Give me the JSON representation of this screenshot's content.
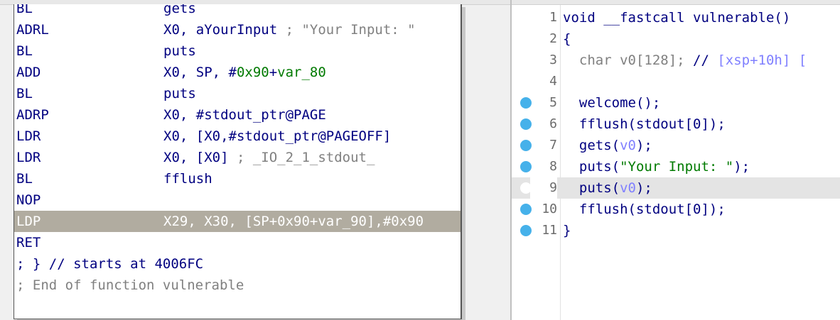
{
  "disassembly": {
    "lines": [
      {
        "mnemonic": "BL",
        "operands": [
          {
            "text": "gets",
            "color": "#000080"
          }
        ]
      },
      {
        "mnemonic": "ADRL",
        "operands": [
          {
            "text": "X0, aYourInput",
            "color": "#000080"
          },
          {
            "text": " ; \"Your Input: \"",
            "color": "#808080"
          }
        ]
      },
      {
        "mnemonic": "BL",
        "operands": [
          {
            "text": "puts",
            "color": "#000080"
          }
        ]
      },
      {
        "mnemonic": "ADD",
        "operands": [
          {
            "text": "X0, SP, #",
            "color": "#000080"
          },
          {
            "text": "0x90",
            "color": "#007a00"
          },
          {
            "text": "+",
            "color": "#000080"
          },
          {
            "text": "var_80",
            "color": "#007a00"
          }
        ]
      },
      {
        "mnemonic": "BL",
        "operands": [
          {
            "text": "puts",
            "color": "#000080"
          }
        ]
      },
      {
        "mnemonic": "ADRP",
        "operands": [
          {
            "text": "X0, #stdout_ptr@PAGE",
            "color": "#000080"
          }
        ]
      },
      {
        "mnemonic": "LDR",
        "operands": [
          {
            "text": "X0, [X0,#stdout_ptr@PAGEOFF]",
            "color": "#000080"
          }
        ]
      },
      {
        "mnemonic": "LDR",
        "operands": [
          {
            "text": "X0, [X0]",
            "color": "#000080"
          },
          {
            "text": " ; _IO_2_1_stdout_",
            "color": "#808080"
          }
        ]
      },
      {
        "mnemonic": "BL",
        "operands": [
          {
            "text": "fflush",
            "color": "#000080"
          }
        ]
      },
      {
        "mnemonic": "NOP",
        "operands": []
      },
      {
        "mnemonic": "LDP",
        "operands": [
          {
            "text": "X29, X30, [SP+0x90+var_90],#0x90",
            "color": "#ffffff"
          }
        ],
        "highlighted": true
      },
      {
        "mnemonic": "RET",
        "operands": []
      }
    ],
    "comment_end_1": "; } // starts at 4006FC",
    "comment_end_2": "; End of function vulnerable"
  },
  "pseudocode": {
    "lines": [
      {
        "number": "1",
        "dot": false,
        "tokens": [
          {
            "text": "void __fastcall vulnerable()",
            "color": "#000080"
          }
        ]
      },
      {
        "number": "2",
        "dot": false,
        "tokens": [
          {
            "text": "{",
            "color": "#000080"
          }
        ]
      },
      {
        "number": "3",
        "dot": false,
        "tokens": [
          {
            "text": "  char v0[128]; ",
            "color": "#808080"
          },
          {
            "text": "// ",
            "color": "#000080"
          },
          {
            "text": "[xsp+10h] [",
            "color": "#8080ff"
          }
        ]
      },
      {
        "number": "4",
        "dot": false,
        "tokens": []
      },
      {
        "number": "5",
        "dot": true,
        "tokens": [
          {
            "text": "  welcome();",
            "color": "#000080"
          }
        ]
      },
      {
        "number": "6",
        "dot": true,
        "tokens": [
          {
            "text": "  fflush(stdout[0]);",
            "color": "#000080"
          }
        ]
      },
      {
        "number": "7",
        "dot": true,
        "tokens": [
          {
            "text": "  gets(",
            "color": "#000080"
          },
          {
            "text": "v0",
            "color": "#8080ff"
          },
          {
            "text": ");",
            "color": "#000080"
          }
        ]
      },
      {
        "number": "8",
        "dot": true,
        "tokens": [
          {
            "text": "  puts(",
            "color": "#000080"
          },
          {
            "text": "\"Your Input: \"",
            "color": "#007a00"
          },
          {
            "text": ");",
            "color": "#000080"
          }
        ]
      },
      {
        "number": "9",
        "dot": true,
        "current": true,
        "tokens": [
          {
            "text": "  puts(",
            "color": "#000080"
          },
          {
            "text": "v0",
            "color": "#8080ff"
          },
          {
            "text": ");",
            "color": "#000080"
          }
        ]
      },
      {
        "number": "10",
        "dot": true,
        "tokens": [
          {
            "text": "  fflush(stdout[0]);",
            "color": "#000080"
          }
        ]
      },
      {
        "number": "11",
        "dot": true,
        "tokens": [
          {
            "text": "}",
            "color": "#000080"
          }
        ]
      }
    ]
  }
}
